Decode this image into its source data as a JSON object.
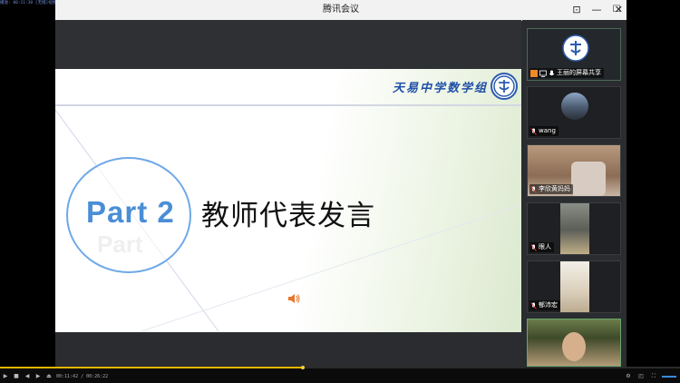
{
  "player": {
    "top_info": "播放: 00:11:30 [无缝]视频MP4",
    "progress": 0.445,
    "time_display": "00:11:42 / 00:26:22",
    "buttons": [
      "play",
      "stop",
      "prev",
      "next",
      "open"
    ],
    "right_buttons": [
      "settings",
      "screenshot",
      "fullscreen",
      "volume"
    ]
  },
  "window": {
    "title": "腾讯会议",
    "controls": {
      "pin": "⊡",
      "minimize": "—",
      "maximize": "☐",
      "close": "✕"
    }
  },
  "slide": {
    "school_title": "天易中学数学组",
    "part_label": "Part 2",
    "part_shadow": "Part",
    "heading": "教师代表发言",
    "accent_color": "#4a8ed6",
    "title_color": "#1f4fa8"
  },
  "participants": [
    {
      "name": "王丽的屏幕共享",
      "type": "screen-share",
      "icon": "school-logo"
    },
    {
      "name": "wang",
      "type": "avatar",
      "icon": "profile-photo"
    },
    {
      "name": "李欣黄妈妈",
      "type": "video",
      "icon": "camera-video"
    },
    {
      "name": "眼人",
      "type": "video",
      "icon": "camera-video"
    },
    {
      "name": "郁沛宏",
      "type": "video",
      "icon": "camera-video"
    },
    {
      "name": "",
      "type": "video",
      "icon": "camera-video"
    }
  ]
}
